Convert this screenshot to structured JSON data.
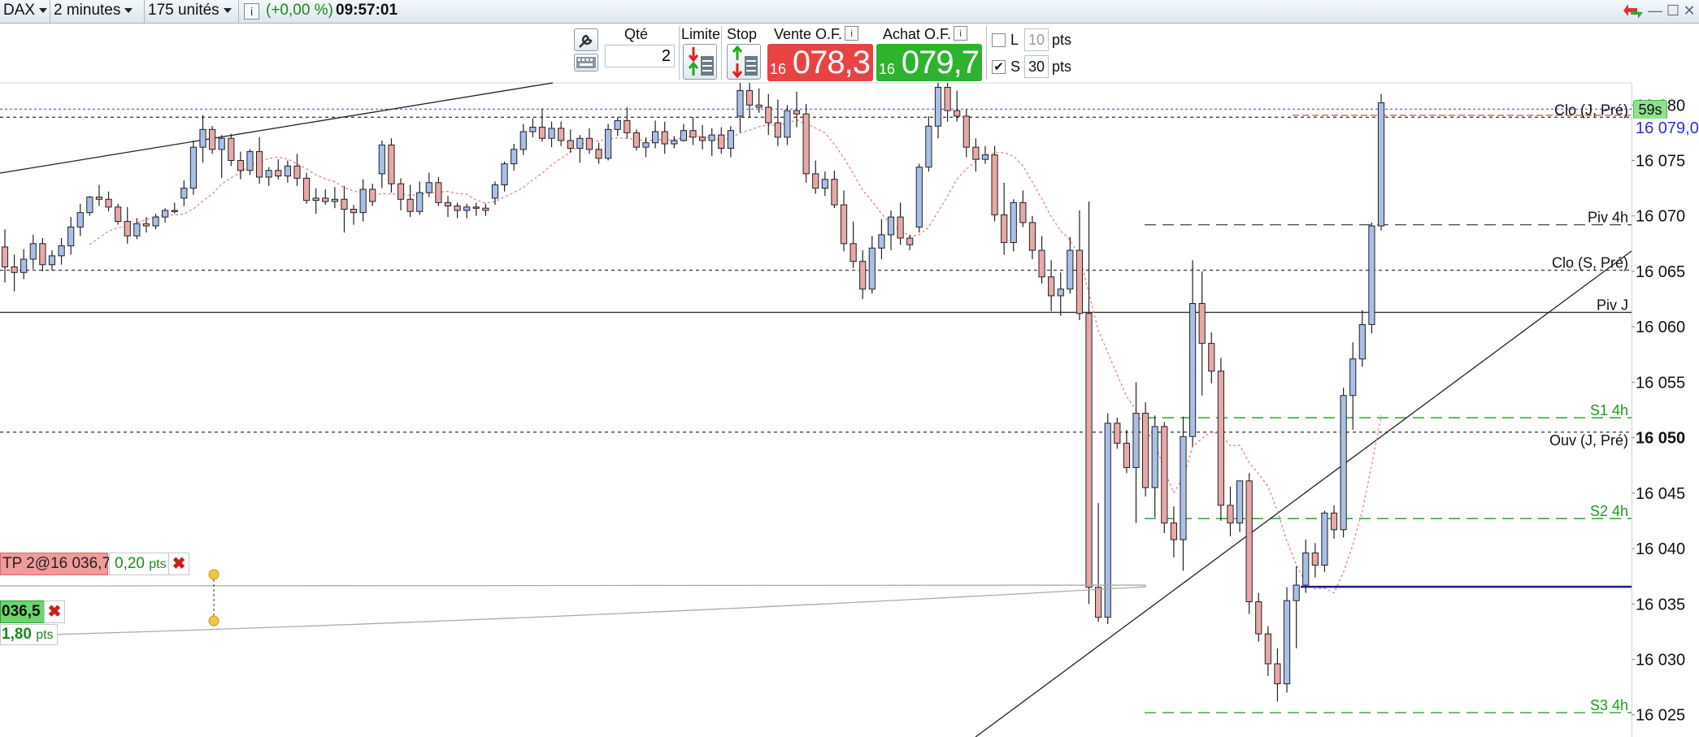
{
  "topbar": {
    "instrument": "DAX",
    "interval": "2 minutes",
    "units": "175 unités",
    "change": "(+0,00 %)",
    "time": "09:57:01"
  },
  "ticket": {
    "qty_label": "Qté",
    "qty_value": "2",
    "limit_label": "Limite",
    "stop_label": "Stop",
    "sell_label": "Vente O.F.",
    "buy_label": "Achat O.F.",
    "sell_prefix": "16",
    "sell_price": "078,3",
    "buy_prefix": "16",
    "buy_price": "079,7",
    "l_label": "L",
    "l_value": "10",
    "l_unit": "pts",
    "s_label": "S",
    "s_value": "30",
    "s_unit": "pts"
  },
  "colors": {
    "sell": "#e84343",
    "buy": "#2db32d",
    "up_candle": "#a9bfe8",
    "down_candle": "#e8a8a8",
    "support": "#1d9a1d",
    "current_position": "#1c1c8a"
  },
  "axis": {
    "ticks": [
      "16 080",
      "16 075",
      "16 070",
      "16 065",
      "16 060",
      "16 055",
      "16 050",
      "16 045",
      "16 040",
      "16 035",
      "16 030",
      "16 025"
    ],
    "timer": "59s",
    "last_price": "16 079,0"
  },
  "levels": {
    "clo_j": "Clo (J, Pré)",
    "piv_4h": "Piv 4h",
    "clo_s": "Clo (S, Pré)",
    "piv_j": "Piv J",
    "s1_4h": "S1 4h",
    "ouv_j": "Ouv (J, Pré)",
    "s2_4h": "S2 4h",
    "s3_4h": "S3 4h"
  },
  "orders": {
    "tp_label": "TP 2@16 036,7",
    "tp_pts": "0,20",
    "tp_pts_unit": "pts",
    "sl_label": "036,5",
    "sl_pts": "1,80",
    "sl_pts_unit": "pts"
  },
  "chart_data": {
    "type": "candlestick",
    "instrument": "DAX",
    "interval": "2 minutes",
    "ylim": [
      16023,
      16082
    ],
    "price_lines": {
      "Clo (J, Pré)": 16078.9,
      "Piv 4h": 16069.2,
      "Clo (S, Pré)": 16065.1,
      "Piv J": 16061.3,
      "S1 4h": 16051.8,
      "Ouv (J, Pré)": 16050.5,
      "S2 4h": 16042.7,
      "S3 4h": 16025.2,
      "TP": 16036.7,
      "S": 16036.5
    },
    "last_price": 16079.0,
    "candles": [
      [
        16067.2,
        16068.8,
        16064.0,
        16065.4
      ],
      [
        16065.4,
        16066.5,
        16063.2,
        16064.9
      ],
      [
        16064.9,
        16067.0,
        16064.3,
        16066.1
      ],
      [
        16066.1,
        16068.3,
        16065.2,
        16067.5
      ],
      [
        16067.5,
        16068.0,
        16065.0,
        16065.6
      ],
      [
        16065.6,
        16066.9,
        16065.1,
        16066.4
      ],
      [
        16066.4,
        16068.0,
        16065.6,
        16067.3
      ],
      [
        16067.3,
        16069.9,
        16066.5,
        16069.0
      ],
      [
        16069.0,
        16071.1,
        16068.2,
        16070.3
      ],
      [
        16070.3,
        16071.8,
        16070.0,
        16071.7
      ],
      [
        16071.7,
        16072.8,
        16070.9,
        16071.5
      ],
      [
        16071.5,
        16072.2,
        16070.4,
        16070.8
      ],
      [
        16070.8,
        16071.1,
        16069.2,
        16069.5
      ],
      [
        16069.5,
        16070.8,
        16067.5,
        16068.2
      ],
      [
        16068.2,
        16069.8,
        16067.9,
        16069.3
      ],
      [
        16069.3,
        16069.9,
        16068.5,
        16069.1
      ],
      [
        16069.1,
        16070.2,
        16068.8,
        16069.9
      ],
      [
        16069.9,
        16070.7,
        16069.4,
        16070.5
      ],
      [
        16070.5,
        16071.2,
        16070.2,
        16070.4
      ],
      [
        16071.6,
        16073.2,
        16070.9,
        16072.5
      ],
      [
        16072.5,
        16076.8,
        16071.9,
        16076.2
      ],
      [
        16076.2,
        16079.1,
        16074.8,
        16077.8
      ],
      [
        16077.8,
        16078.1,
        16075.6,
        16076.0
      ],
      [
        16076.0,
        16077.3,
        16073.4,
        16077.0
      ],
      [
        16077.0,
        16077.4,
        16074.5,
        16075.0
      ],
      [
        16075.0,
        16075.8,
        16073.3,
        16074.1
      ],
      [
        16074.1,
        16076.0,
        16073.7,
        16075.8
      ],
      [
        16075.8,
        16077.1,
        16072.9,
        16073.5
      ],
      [
        16073.5,
        16074.4,
        16072.7,
        16074.1
      ],
      [
        16074.1,
        16075.1,
        16073.3,
        16073.6
      ],
      [
        16073.6,
        16075.0,
        16073.0,
        16074.5
      ],
      [
        16074.5,
        16075.6,
        16072.7,
        16073.4
      ],
      [
        16073.4,
        16073.9,
        16071.1,
        16071.4
      ],
      [
        16071.4,
        16072.5,
        16070.2,
        16071.6
      ],
      [
        16071.6,
        16072.4,
        16071.0,
        16071.3
      ],
      [
        16071.3,
        16072.6,
        16070.7,
        16071.5
      ],
      [
        16071.5,
        16072.7,
        16068.5,
        16070.6
      ],
      [
        16070.6,
        16071.0,
        16069.2,
        16070.3
      ],
      [
        16070.3,
        16073.3,
        16069.5,
        16072.4
      ],
      [
        16072.4,
        16072.9,
        16070.9,
        16071.3
      ],
      [
        16073.8,
        16076.8,
        16072.5,
        16076.4
      ],
      [
        16076.4,
        16077.0,
        16072.1,
        16072.9
      ],
      [
        16072.9,
        16073.4,
        16070.5,
        16071.5
      ],
      [
        16071.5,
        16072.8,
        16069.9,
        16070.4
      ],
      [
        16070.4,
        16073.1,
        16070.1,
        16072.1
      ],
      [
        16072.1,
        16073.9,
        16071.7,
        16073.0
      ],
      [
        16073.0,
        16073.5,
        16070.9,
        16071.2
      ],
      [
        16071.2,
        16071.8,
        16069.9,
        16070.9
      ],
      [
        16070.9,
        16071.2,
        16069.8,
        16070.5
      ],
      [
        16070.5,
        16071.1,
        16069.8,
        16070.8
      ],
      [
        16070.8,
        16071.2,
        16070.0,
        16070.7
      ],
      [
        16070.7,
        16071.1,
        16070.0,
        16070.5
      ],
      [
        16071.6,
        16073.1,
        16071.0,
        16072.8
      ],
      [
        16072.8,
        16074.9,
        16072.2,
        16074.7
      ],
      [
        16074.7,
        16076.5,
        16074.1,
        16076.0
      ],
      [
        16076.0,
        16078.3,
        16075.5,
        16077.6
      ],
      [
        16077.6,
        16078.8,
        16077.1,
        16078.0
      ],
      [
        16078.0,
        16079.7,
        16076.7,
        16077.0
      ],
      [
        16077.0,
        16078.5,
        16076.2,
        16077.9
      ],
      [
        16077.9,
        16078.5,
        16076.3,
        16076.8
      ],
      [
        16076.8,
        16077.8,
        16075.7,
        16076.1
      ],
      [
        16076.1,
        16077.3,
        16074.8,
        16077.0
      ],
      [
        16077.0,
        16077.9,
        16075.6,
        16076.0
      ],
      [
        16076.0,
        16076.6,
        16074.7,
        16075.2
      ],
      [
        16075.2,
        16078.3,
        16075.0,
        16077.8
      ],
      [
        16077.8,
        16078.9,
        16077.2,
        16078.6
      ],
      [
        16078.6,
        16079.8,
        16077.0,
        16077.5
      ],
      [
        16077.5,
        16077.8,
        16075.9,
        16076.2
      ],
      [
        16076.2,
        16077.1,
        16075.3,
        16076.6
      ],
      [
        16076.6,
        16078.6,
        16076.1,
        16077.6
      ],
      [
        16077.6,
        16078.5,
        16075.6,
        16076.5
      ],
      [
        16076.5,
        16077.2,
        16076.1,
        16076.8
      ],
      [
        16076.8,
        16078.3,
        16076.7,
        16077.7
      ],
      [
        16077.7,
        16078.9,
        16076.4,
        16077.1
      ],
      [
        16077.1,
        16078.2,
        16076.0,
        16076.8
      ],
      [
        16076.8,
        16077.9,
        16075.4,
        16077.3
      ],
      [
        16077.3,
        16078.0,
        16075.6,
        16076.1
      ],
      [
        16076.1,
        16078.1,
        16075.3,
        16077.7
      ],
      [
        16079.0,
        16082.0,
        16077.5,
        16081.3
      ],
      [
        16081.3,
        16082.0,
        16078.9,
        16080.0
      ],
      [
        16080.0,
        16081.5,
        16079.3,
        16079.8
      ],
      [
        16079.8,
        16081.0,
        16077.3,
        16078.4
      ],
      [
        16078.4,
        16080.5,
        16076.3,
        16077.1
      ],
      [
        16077.1,
        16080.0,
        16076.4,
        16079.5
      ],
      [
        16079.5,
        16081.2,
        16078.0,
        16079.2
      ],
      [
        16079.2,
        16080.1,
        16073.0,
        16073.8
      ],
      [
        16073.8,
        16075.0,
        16072.0,
        16072.5
      ],
      [
        16072.5,
        16074.0,
        16071.8,
        16073.3
      ],
      [
        16073.3,
        16074.1,
        16070.7,
        16071.0
      ],
      [
        16071.0,
        16072.3,
        16066.8,
        16067.5
      ],
      [
        16067.5,
        16069.5,
        16065.3,
        16065.9
      ],
      [
        16065.9,
        16066.9,
        16062.5,
        16063.4
      ],
      [
        16063.4,
        16068.2,
        16063.0,
        16067.1
      ],
      [
        16067.1,
        16069.7,
        16066.1,
        16068.3
      ],
      [
        16068.3,
        16070.5,
        16066.9,
        16069.9
      ],
      [
        16069.9,
        16071.2,
        16067.4,
        16068.0
      ],
      [
        16068.0,
        16068.3,
        16066.9,
        16067.4
      ],
      [
        16069.0,
        16074.7,
        16068.5,
        16074.4
      ],
      [
        16074.4,
        16079.0,
        16074.0,
        16078.1
      ],
      [
        16078.1,
        16082.0,
        16077.0,
        16081.6
      ],
      [
        16081.6,
        16082.0,
        16078.5,
        16079.5
      ],
      [
        16079.5,
        16081.3,
        16078.5,
        16079.0
      ],
      [
        16079.0,
        16079.6,
        16075.3,
        16076.2
      ],
      [
        16076.2,
        16077.0,
        16074.0,
        16075.1
      ],
      [
        16075.1,
        16076.3,
        16074.7,
        16075.5
      ],
      [
        16075.5,
        16076.3,
        16069.5,
        16070.1
      ],
      [
        16070.1,
        16073.0,
        16066.5,
        16067.6
      ],
      [
        16067.6,
        16071.5,
        16066.8,
        16071.2
      ],
      [
        16071.2,
        16072.3,
        16069.0,
        16069.4
      ],
      [
        16069.4,
        16070.0,
        16066.1,
        16066.9
      ],
      [
        16066.9,
        16068.2,
        16063.9,
        16064.5
      ],
      [
        16064.5,
        16066.0,
        16061.4,
        16062.8
      ],
      [
        16062.8,
        16064.9,
        16061.0,
        16063.4
      ],
      [
        16063.4,
        16068.1,
        16063.0,
        16066.9
      ],
      [
        16066.9,
        16070.5,
        16060.6,
        16061.2
      ],
      [
        16061.2,
        16071.3,
        16035.0,
        16036.5
      ],
      [
        16036.5,
        16044.1,
        16033.4,
        16033.8
      ],
      [
        16033.8,
        16052.2,
        16033.2,
        16051.3
      ],
      [
        16051.3,
        16051.8,
        16049.0,
        16049.5
      ],
      [
        16049.5,
        16050.7,
        16046.8,
        16047.3
      ],
      [
        16047.3,
        16055.0,
        16042.3,
        16052.2
      ],
      [
        16052.2,
        16053.2,
        16044.7,
        16045.5
      ],
      [
        16045.5,
        16052.0,
        16042.8,
        16051.0
      ],
      [
        16051.0,
        16051.4,
        16041.4,
        16042.3
      ],
      [
        16042.3,
        16043.8,
        16039.2,
        16040.8
      ],
      [
        16040.8,
        16051.9,
        16038.0,
        16050.1
      ],
      [
        16050.1,
        16066.0,
        16049.2,
        16062.1
      ],
      [
        16062.1,
        16065.0,
        16053.8,
        16058.5
      ],
      [
        16058.5,
        16059.5,
        16054.9,
        16056.0
      ],
      [
        16056.0,
        16057.2,
        16042.5,
        16043.9
      ],
      [
        16043.9,
        16045.6,
        16041.1,
        16042.3
      ],
      [
        16042.3,
        16046.0,
        16041.5,
        16046.1
      ],
      [
        16046.1,
        16046.8,
        16034.1,
        16035.2
      ],
      [
        16035.2,
        16036.0,
        16031.6,
        16032.3
      ],
      [
        16032.3,
        16033.0,
        16028.5,
        16029.6
      ],
      [
        16029.6,
        16031.0,
        16026.2,
        16027.8
      ],
      [
        16027.8,
        16036.5,
        16027.0,
        16035.3
      ],
      [
        16035.3,
        16038.4,
        16031.0,
        16036.7
      ],
      [
        16036.7,
        16040.8,
        16036.0,
        16039.6
      ],
      [
        16039.6,
        16040.5,
        16037.4,
        16038.5
      ],
      [
        16038.5,
        16043.4,
        16037.9,
        16043.2
      ],
      [
        16043.2,
        16043.9,
        16040.9,
        16041.7
      ],
      [
        16041.7,
        16054.5,
        16041.0,
        16053.8
      ],
      [
        16053.8,
        16058.6,
        16050.7,
        16057.1
      ],
      [
        16057.1,
        16061.5,
        16056.4,
        16060.2
      ],
      [
        16060.2,
        16069.4,
        16059.4,
        16069.1
      ],
      [
        16069.1,
        16081.0,
        16068.7,
        16080.2
      ]
    ]
  }
}
